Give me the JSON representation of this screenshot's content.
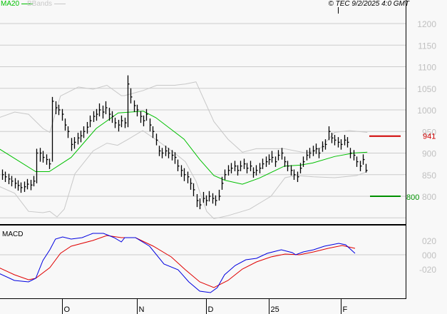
{
  "header": {
    "legend_ma": "MA20",
    "legend_bbands": "BBands",
    "copyright": "© TEC 9/2/2025 4:0 GMT"
  },
  "colors": {
    "ma": "#00c000",
    "bbands": "#c8c8c8",
    "bars": "#000000",
    "macd": "#0000e0",
    "signal": "#e00000",
    "resistance": "#d00000",
    "support": "#009000",
    "grid": "#cccccc",
    "axis_text": "#c0c0c0"
  },
  "chart_data": [
    {
      "type": "ohlc",
      "title": "",
      "yticks": [
        800,
        850,
        900,
        950,
        1000,
        1050,
        1100,
        1150,
        1200
      ],
      "ytick_labels": [
        "800",
        "850",
        "900",
        "950",
        "1000",
        "1050",
        "1100",
        "1150",
        "1200"
      ],
      "ylim": [
        750,
        1250
      ],
      "grid": true,
      "resistance": {
        "value": 941,
        "label": "941"
      },
      "support": {
        "value": 800,
        "label": "800"
      },
      "bars_format": [
        "high",
        "low",
        "close"
      ],
      "bars": [
        [
          862,
          838,
          850
        ],
        [
          857,
          833,
          845
        ],
        [
          852,
          828,
          840
        ],
        [
          847,
          823,
          835
        ],
        [
          842,
          818,
          830
        ],
        [
          837,
          813,
          825
        ],
        [
          832,
          808,
          820
        ],
        [
          834,
          810,
          822
        ],
        [
          840,
          816,
          828
        ],
        [
          838,
          814,
          826
        ],
        [
          847,
          823,
          835
        ],
        [
          910,
          830,
          900
        ],
        [
          912,
          880,
          900
        ],
        [
          905,
          878,
          890
        ],
        [
          897,
          873,
          885
        ],
        [
          887,
          863,
          875
        ],
        [
          1030,
          880,
          1020
        ],
        [
          1020,
          990,
          1005
        ],
        [
          1012,
          988,
          1000
        ],
        [
          1002,
          975,
          990
        ],
        [
          980,
          952,
          965
        ],
        [
          962,
          935,
          950
        ],
        [
          935,
          905,
          920
        ],
        [
          937,
          910,
          925
        ],
        [
          947,
          920,
          935
        ],
        [
          952,
          925,
          940
        ],
        [
          962,
          935,
          950
        ],
        [
          972,
          945,
          960
        ],
        [
          987,
          960,
          975
        ],
        [
          997,
          972,
          985
        ],
        [
          1002,
          975,
          990
        ],
        [
          1015,
          985,
          1000
        ],
        [
          1010,
          980,
          995
        ],
        [
          1020,
          990,
          1005
        ],
        [
          1005,
          975,
          990
        ],
        [
          997,
          970,
          985
        ],
        [
          982,
          958,
          970
        ],
        [
          977,
          950,
          965
        ],
        [
          987,
          960,
          975
        ],
        [
          982,
          958,
          970
        ],
        [
          1080,
          960,
          1060
        ],
        [
          1050,
          1015,
          1030
        ],
        [
          1022,
          995,
          1010
        ],
        [
          1012,
          985,
          1000
        ],
        [
          997,
          970,
          985
        ],
        [
          987,
          962,
          975
        ],
        [
          1002,
          975,
          990
        ],
        [
          980,
          950,
          965
        ],
        [
          962,
          935,
          950
        ],
        [
          945,
          918,
          930
        ],
        [
          917,
          893,
          905
        ],
        [
          912,
          888,
          900
        ],
        [
          917,
          893,
          905
        ],
        [
          912,
          888,
          900
        ],
        [
          907,
          883,
          895
        ],
        [
          902,
          875,
          890
        ],
        [
          885,
          858,
          870
        ],
        [
          872,
          845,
          860
        ],
        [
          865,
          835,
          850
        ],
        [
          857,
          830,
          845
        ],
        [
          842,
          815,
          830
        ],
        [
          830,
          800,
          815
        ],
        [
          805,
          775,
          790
        ],
        [
          795,
          770,
          780
        ],
        [
          810,
          785,
          795
        ],
        [
          802,
          778,
          790
        ],
        [
          812,
          788,
          800
        ],
        [
          807,
          783,
          795
        ],
        [
          802,
          778,
          790
        ],
        [
          815,
          790,
          800
        ],
        [
          845,
          815,
          830
        ],
        [
          862,
          838,
          850
        ],
        [
          872,
          848,
          860
        ],
        [
          877,
          853,
          865
        ],
        [
          882,
          858,
          870
        ],
        [
          872,
          848,
          860
        ],
        [
          882,
          858,
          870
        ],
        [
          887,
          863,
          875
        ],
        [
          877,
          853,
          865
        ],
        [
          882,
          858,
          870
        ],
        [
          867,
          843,
          855
        ],
        [
          872,
          848,
          860
        ],
        [
          877,
          853,
          865
        ],
        [
          887,
          863,
          875
        ],
        [
          892,
          868,
          880
        ],
        [
          897,
          873,
          885
        ],
        [
          905,
          878,
          890
        ],
        [
          892,
          868,
          880
        ],
        [
          907,
          883,
          895
        ],
        [
          912,
          885,
          900
        ],
        [
          892,
          868,
          880
        ],
        [
          882,
          858,
          870
        ],
        [
          872,
          848,
          860
        ],
        [
          862,
          838,
          850
        ],
        [
          857,
          833,
          845
        ],
        [
          877,
          853,
          865
        ],
        [
          892,
          868,
          880
        ],
        [
          907,
          883,
          895
        ],
        [
          912,
          888,
          900
        ],
        [
          917,
          893,
          905
        ],
        [
          922,
          898,
          910
        ],
        [
          912,
          888,
          900
        ],
        [
          927,
          903,
          915
        ],
        [
          932,
          908,
          920
        ],
        [
          962,
          930,
          950
        ],
        [
          947,
          923,
          935
        ],
        [
          942,
          918,
          930
        ],
        [
          937,
          913,
          925
        ],
        [
          932,
          908,
          920
        ],
        [
          942,
          918,
          930
        ],
        [
          937,
          913,
          925
        ],
        [
          912,
          888,
          900
        ],
        [
          907,
          883,
          895
        ],
        [
          892,
          868,
          880
        ],
        [
          882,
          858,
          870
        ],
        [
          897,
          873,
          885
        ],
        [
          875,
          855,
          860
        ]
      ],
      "x_tick_labels": [
        {
          "label": "O",
          "index": 19
        },
        {
          "label": "N",
          "index": 43
        },
        {
          "label": "D",
          "index": 65
        },
        {
          "label": "25",
          "index": 85
        },
        {
          "label": "F",
          "index": 108
        }
      ],
      "series": [
        {
          "name": "MA20",
          "points": [
            [
              -1,
              910
            ],
            [
              10.7,
              857
            ],
            [
              15,
              857
            ],
            [
              22,
              890
            ],
            [
              30,
              957
            ],
            [
              37,
              993
            ],
            [
              45,
              997
            ],
            [
              49,
              982
            ],
            [
              58,
              932
            ],
            [
              63,
              885
            ],
            [
              67.5,
              848
            ],
            [
              71,
              837
            ],
            [
              76.6,
              828
            ],
            [
              82,
              842
            ],
            [
              90,
              870
            ],
            [
              95,
              872
            ],
            [
              99,
              877
            ],
            [
              106,
              892
            ],
            [
              112,
              900
            ],
            [
              116.4,
              902
            ]
          ]
        },
        {
          "name": "BBands upper",
          "points": [
            [
              -1,
              982
            ],
            [
              4,
              995
            ],
            [
              8.4,
              990
            ],
            [
              13,
              957
            ],
            [
              15.2,
              948
            ],
            [
              18.6,
              1032
            ],
            [
              24.3,
              1053
            ],
            [
              29,
              1048
            ],
            [
              33.4,
              1057
            ],
            [
              38,
              1033
            ],
            [
              39,
              1033
            ],
            [
              45,
              1045
            ],
            [
              49.3,
              1057
            ],
            [
              55,
              1057
            ],
            [
              58.4,
              1060
            ],
            [
              61.8,
              1065
            ],
            [
              67.5,
              973
            ],
            [
              72,
              932
            ],
            [
              76.6,
              902
            ],
            [
              81,
              910
            ],
            [
              90,
              910
            ],
            [
              97,
              900
            ],
            [
              101.6,
              912
            ],
            [
              106,
              948
            ],
            [
              110.7,
              952
            ],
            [
              116.4,
              948
            ]
          ]
        },
        {
          "name": "BBands lower",
          "points": [
            [
              -1,
              823
            ],
            [
              4,
              807
            ],
            [
              8.4,
              765
            ],
            [
              13,
              762
            ],
            [
              15.2,
              765
            ],
            [
              17.5,
              752
            ],
            [
              19.8,
              770
            ],
            [
              23.2,
              852
            ],
            [
              29,
              905
            ],
            [
              33.4,
              923
            ],
            [
              36.8,
              918
            ],
            [
              40.2,
              932
            ],
            [
              44.8,
              952
            ],
            [
              49.3,
              930
            ],
            [
              55,
              900
            ],
            [
              58.4,
              880
            ],
            [
              61.8,
              835
            ],
            [
              65.2,
              765
            ],
            [
              67.5,
              748
            ],
            [
              72,
              755
            ],
            [
              78.9,
              770
            ],
            [
              85.7,
              800
            ],
            [
              90.2,
              843
            ],
            [
              93.6,
              848
            ],
            [
              99.3,
              845
            ],
            [
              106,
              843
            ],
            [
              113,
              848
            ],
            [
              116.4,
              857
            ]
          ]
        }
      ]
    },
    {
      "type": "line",
      "title": "MACD",
      "yticks": [
        0.2,
        0,
        -0.2
      ],
      "ytick_labels": [
        "020",
        "000",
        "-020"
      ],
      "ylim": [
        -0.6,
        0.45
      ],
      "series": [
        {
          "name": "MACD",
          "points": [
            [
              -1,
              -0.26
            ],
            [
              3.9,
              -0.36
            ],
            [
              8.4,
              -0.38
            ],
            [
              10.7,
              -0.33
            ],
            [
              13,
              -0.08
            ],
            [
              15.2,
              0.07
            ],
            [
              17,
              0.22
            ],
            [
              19.3,
              0.25
            ],
            [
              22,
              0.22
            ],
            [
              25.5,
              0.24
            ],
            [
              28.9,
              0.3
            ],
            [
              32.3,
              0.3
            ],
            [
              35.7,
              0.24
            ],
            [
              38,
              0.18
            ],
            [
              39.1,
              0.24
            ],
            [
              42.5,
              0.24
            ],
            [
              47,
              0.12
            ],
            [
              51.6,
              -0.13
            ],
            [
              56.1,
              -0.21
            ],
            [
              59.5,
              -0.38
            ],
            [
              63,
              -0.51
            ],
            [
              66.4,
              -0.53
            ],
            [
              68.6,
              -0.46
            ],
            [
              70.9,
              -0.28
            ],
            [
              74.3,
              -0.15
            ],
            [
              77.7,
              -0.07
            ],
            [
              81.1,
              -0.05
            ],
            [
              84.5,
              0.02
            ],
            [
              89,
              0.07
            ],
            [
              92.5,
              0.03
            ],
            [
              93.6,
              0
            ],
            [
              96,
              0.04
            ],
            [
              99.3,
              0.07
            ],
            [
              102.7,
              0.12
            ],
            [
              107.3,
              0.16
            ],
            [
              109.5,
              0.14
            ],
            [
              112.5,
              0.02
            ]
          ]
        },
        {
          "name": "Signal",
          "points": [
            [
              -1,
              -0.18
            ],
            [
              3.9,
              -0.28
            ],
            [
              8.4,
              -0.35
            ],
            [
              10.7,
              -0.33
            ],
            [
              15.2,
              -0.18
            ],
            [
              18.6,
              0.02
            ],
            [
              22,
              0.12
            ],
            [
              28.9,
              0.2
            ],
            [
              33.4,
              0.27
            ],
            [
              38,
              0.24
            ],
            [
              42.5,
              0.24
            ],
            [
              48.2,
              0.12
            ],
            [
              53.9,
              -0.03
            ],
            [
              58.4,
              -0.21
            ],
            [
              63,
              -0.38
            ],
            [
              67.5,
              -0.46
            ],
            [
              72,
              -0.36
            ],
            [
              76.6,
              -0.2
            ],
            [
              81.1,
              -0.1
            ],
            [
              85.7,
              -0.03
            ],
            [
              90.2,
              0.01
            ],
            [
              94.8,
              0
            ],
            [
              99.3,
              0.04
            ],
            [
              103.9,
              0.09
            ],
            [
              108.4,
              0.13
            ],
            [
              112.5,
              0.09
            ]
          ]
        }
      ]
    }
  ]
}
